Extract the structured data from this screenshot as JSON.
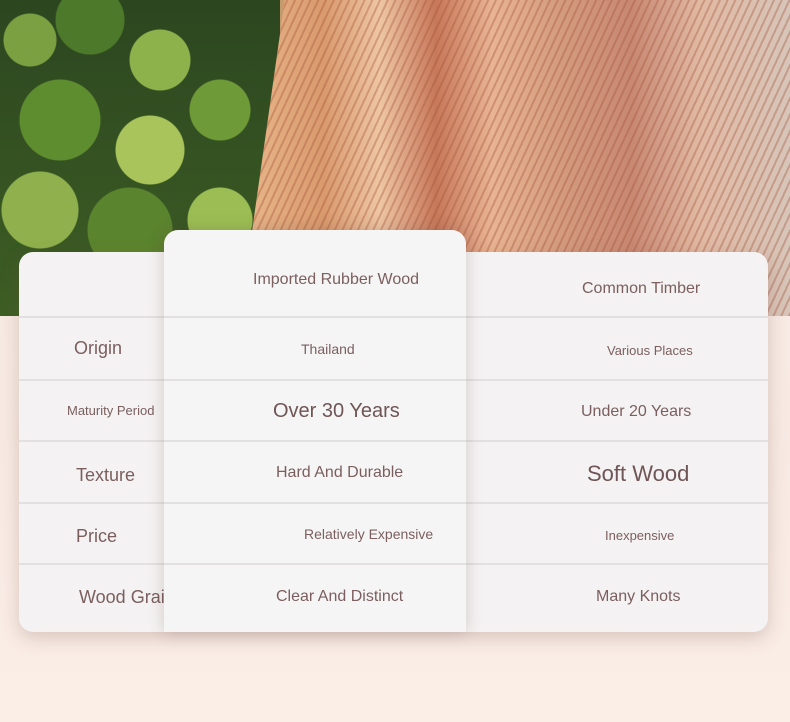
{
  "table": {
    "headers": {
      "feature": "Imported Rubber Wood",
      "compare": "Common Timber"
    },
    "rows": [
      {
        "label": "Origin",
        "feature": "Thailand",
        "compare": "Various Places"
      },
      {
        "label": "Maturity Period",
        "feature": "Over 30 Years",
        "compare": "Under 20 Years"
      },
      {
        "label": "Texture",
        "feature": "Hard And Durable",
        "compare": "Soft Wood"
      },
      {
        "label": "Price",
        "feature": "Relatively Expensive",
        "compare": "Inexpensive"
      },
      {
        "label": "Wood Grain",
        "feature": "Clear And Distinct",
        "compare": "Many Knots"
      }
    ]
  }
}
